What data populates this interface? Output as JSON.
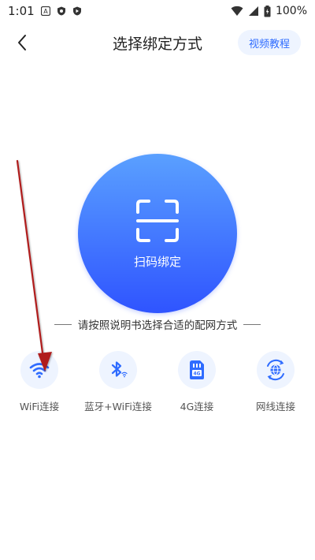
{
  "status_bar": {
    "time": "1:01",
    "battery": "100%",
    "icons": [
      "notification-a-icon",
      "notification-shield-icon",
      "notification-play-icon",
      "wifi-icon",
      "signal-icon",
      "battery-icon"
    ]
  },
  "header": {
    "title": "选择绑定方式",
    "video_tutorial": "视频教程"
  },
  "scan": {
    "label": "扫码绑定"
  },
  "instruction": "请按照说明书选择合适的配网方式",
  "options": [
    {
      "label": "WiFi连接",
      "icon": "wifi-icon"
    },
    {
      "label": "蓝牙+WiFi连接",
      "icon": "bluetooth-icon"
    },
    {
      "label": "4G连接",
      "icon": "sim-card-icon"
    },
    {
      "label": "网线连接",
      "icon": "ethernet-icon"
    }
  ],
  "colors": {
    "accent": "#2f6cff",
    "circle_top": "#5aa0ff",
    "circle_bottom": "#2f54ff",
    "annotation": "#b01e1e"
  }
}
